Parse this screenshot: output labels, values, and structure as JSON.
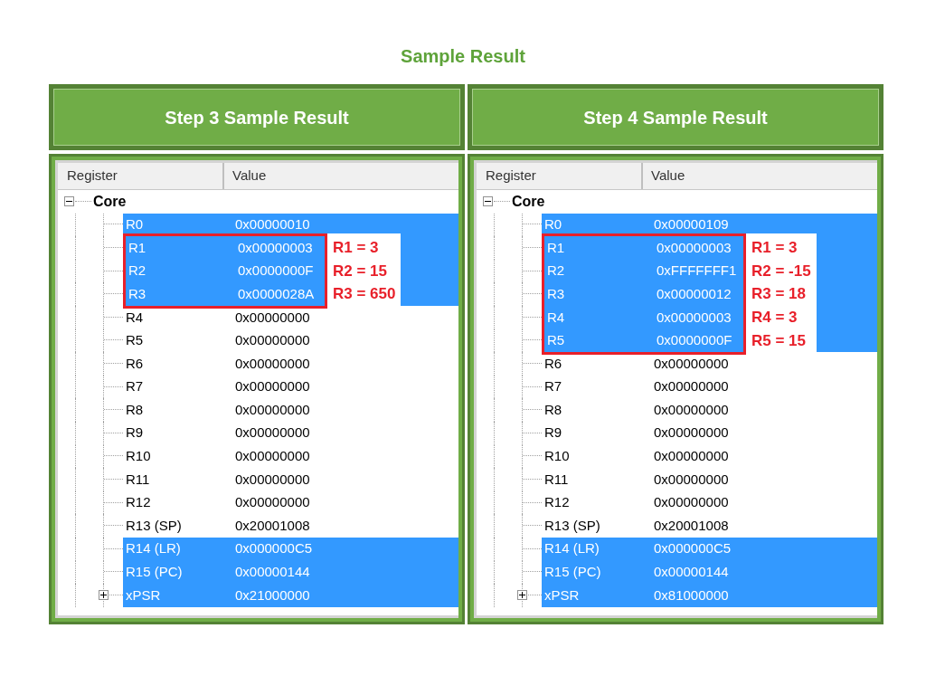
{
  "title": "Sample Result",
  "panels": [
    {
      "heading": "Step 3 Sample Result",
      "columns": [
        "Register",
        "Value"
      ],
      "group": {
        "label": "Core",
        "expanded": true
      },
      "rows": [
        {
          "name": "R0",
          "value": "0x00000010",
          "selected": true,
          "boxed": false
        },
        {
          "name": "R1",
          "value": "0x00000003",
          "selected": true,
          "boxed": true,
          "note": "R1 = 3"
        },
        {
          "name": "R2",
          "value": "0x0000000F",
          "selected": true,
          "boxed": true,
          "note": "R2 = 15"
        },
        {
          "name": "R3",
          "value": "0x0000028A",
          "selected": true,
          "boxed": true,
          "note": "R3 = 650"
        },
        {
          "name": "R4",
          "value": "0x00000000",
          "selected": false,
          "boxed": false
        },
        {
          "name": "R5",
          "value": "0x00000000",
          "selected": false,
          "boxed": false
        },
        {
          "name": "R6",
          "value": "0x00000000",
          "selected": false,
          "boxed": false
        },
        {
          "name": "R7",
          "value": "0x00000000",
          "selected": false,
          "boxed": false
        },
        {
          "name": "R8",
          "value": "0x00000000",
          "selected": false,
          "boxed": false
        },
        {
          "name": "R9",
          "value": "0x00000000",
          "selected": false,
          "boxed": false
        },
        {
          "name": "R10",
          "value": "0x00000000",
          "selected": false,
          "boxed": false
        },
        {
          "name": "R11",
          "value": "0x00000000",
          "selected": false,
          "boxed": false
        },
        {
          "name": "R12",
          "value": "0x00000000",
          "selected": false,
          "boxed": false
        },
        {
          "name": "R13 (SP)",
          "value": "0x20001008",
          "selected": false,
          "boxed": false
        },
        {
          "name": "R14 (LR)",
          "value": "0x000000C5",
          "selected": true,
          "boxed": false
        },
        {
          "name": "R15 (PC)",
          "value": "0x00000144",
          "selected": true,
          "boxed": false
        },
        {
          "name": "xPSR",
          "value": "0x21000000",
          "selected": true,
          "boxed": false,
          "expandable": true
        }
      ]
    },
    {
      "heading": "Step 4 Sample Result",
      "columns": [
        "Register",
        "Value"
      ],
      "group": {
        "label": "Core",
        "expanded": true
      },
      "rows": [
        {
          "name": "R0",
          "value": "0x00000109",
          "selected": true,
          "boxed": false
        },
        {
          "name": "R1",
          "value": "0x00000003",
          "selected": true,
          "boxed": true,
          "note": "R1 = 3"
        },
        {
          "name": "R2",
          "value": "0xFFFFFFF1",
          "selected": true,
          "boxed": true,
          "note": "R2 = -15"
        },
        {
          "name": "R3",
          "value": "0x00000012",
          "selected": true,
          "boxed": true,
          "note": "R3 = 18"
        },
        {
          "name": "R4",
          "value": "0x00000003",
          "selected": true,
          "boxed": true,
          "note": "R4 = 3"
        },
        {
          "name": "R5",
          "value": "0x0000000F",
          "selected": true,
          "boxed": true,
          "note": "R5 = 15"
        },
        {
          "name": "R6",
          "value": "0x00000000",
          "selected": false,
          "boxed": false
        },
        {
          "name": "R7",
          "value": "0x00000000",
          "selected": false,
          "boxed": false
        },
        {
          "name": "R8",
          "value": "0x00000000",
          "selected": false,
          "boxed": false
        },
        {
          "name": "R9",
          "value": "0x00000000",
          "selected": false,
          "boxed": false
        },
        {
          "name": "R10",
          "value": "0x00000000",
          "selected": false,
          "boxed": false
        },
        {
          "name": "R11",
          "value": "0x00000000",
          "selected": false,
          "boxed": false
        },
        {
          "name": "R12",
          "value": "0x00000000",
          "selected": false,
          "boxed": false
        },
        {
          "name": "R13 (SP)",
          "value": "0x20001008",
          "selected": false,
          "boxed": false
        },
        {
          "name": "R14 (LR)",
          "value": "0x000000C5",
          "selected": true,
          "boxed": false
        },
        {
          "name": "R15 (PC)",
          "value": "0x00000144",
          "selected": true,
          "boxed": false
        },
        {
          "name": "xPSR",
          "value": "0x81000000",
          "selected": true,
          "boxed": false,
          "expandable": true
        }
      ]
    }
  ]
}
